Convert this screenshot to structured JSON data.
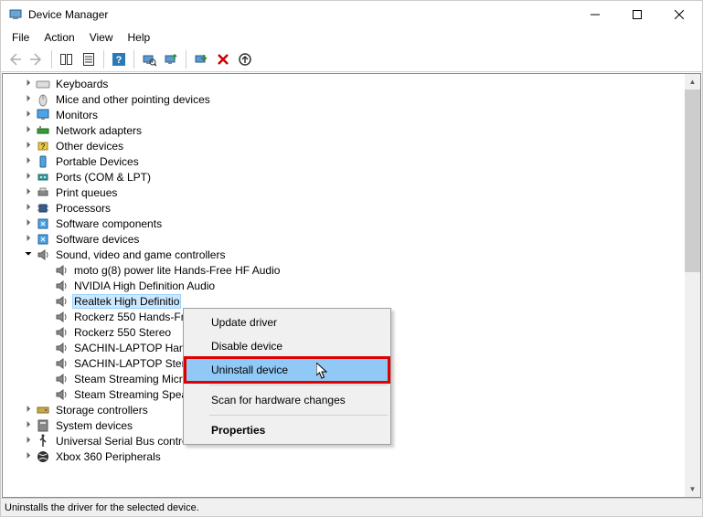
{
  "window": {
    "title": "Device Manager"
  },
  "menu": {
    "file": "File",
    "action": "Action",
    "view": "View",
    "help": "Help"
  },
  "tree": {
    "categories": [
      {
        "label": "Keyboards",
        "expanded": false,
        "icon": "keyboard"
      },
      {
        "label": "Mice and other pointing devices",
        "expanded": false,
        "icon": "mouse"
      },
      {
        "label": "Monitors",
        "expanded": false,
        "icon": "monitor"
      },
      {
        "label": "Network adapters",
        "expanded": false,
        "icon": "network"
      },
      {
        "label": "Other devices",
        "expanded": false,
        "icon": "other"
      },
      {
        "label": "Portable Devices",
        "expanded": false,
        "icon": "portable"
      },
      {
        "label": "Ports (COM & LPT)",
        "expanded": false,
        "icon": "port"
      },
      {
        "label": "Print queues",
        "expanded": false,
        "icon": "printer"
      },
      {
        "label": "Processors",
        "expanded": false,
        "icon": "cpu"
      },
      {
        "label": "Software components",
        "expanded": false,
        "icon": "software"
      },
      {
        "label": "Software devices",
        "expanded": false,
        "icon": "software"
      },
      {
        "label": "Sound, video and game controllers",
        "expanded": true,
        "icon": "sound",
        "children": [
          {
            "label": "moto g(8) power lite Hands-Free HF Audio"
          },
          {
            "label": "NVIDIA High Definition Audio"
          },
          {
            "label": "Realtek High Definitio",
            "selected": true
          },
          {
            "label": "Rockerz 550 Hands-Fr"
          },
          {
            "label": "Rockerz 550 Stereo"
          },
          {
            "label": "SACHIN-LAPTOP Han"
          },
          {
            "label": "SACHIN-LAPTOP Ster"
          },
          {
            "label": "Steam Streaming Micr"
          },
          {
            "label": "Steam Streaming Spea"
          }
        ]
      },
      {
        "label": "Storage controllers",
        "expanded": false,
        "icon": "storage"
      },
      {
        "label": "System devices",
        "expanded": false,
        "icon": "system"
      },
      {
        "label": "Universal Serial Bus controllers",
        "expanded": false,
        "icon": "usb"
      },
      {
        "label": "Xbox 360 Peripherals",
        "expanded": false,
        "icon": "xbox"
      }
    ]
  },
  "context_menu": {
    "items": [
      {
        "label": "Update driver",
        "type": "item"
      },
      {
        "label": "Disable device",
        "type": "item"
      },
      {
        "label": "Uninstall device",
        "type": "item",
        "highlighted": true
      },
      {
        "type": "separator"
      },
      {
        "label": "Scan for hardware changes",
        "type": "item"
      },
      {
        "type": "separator"
      },
      {
        "label": "Properties",
        "type": "item",
        "bold": true
      }
    ]
  },
  "statusbar": {
    "text": "Uninstalls the driver for the selected device."
  }
}
